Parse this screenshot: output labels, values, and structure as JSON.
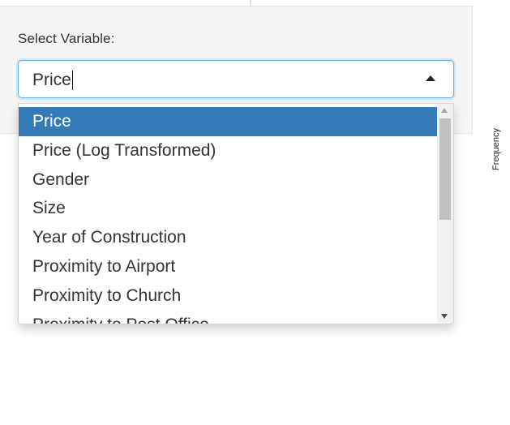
{
  "form": {
    "label": "Select Variable:",
    "selected_value": "Price"
  },
  "dropdown": {
    "options": [
      "Price",
      "Price (Log Transformed)",
      "Gender",
      "Size",
      "Year of Construction",
      "Proximity to Airport",
      "Proximity to Church",
      "Proximity to Post Office"
    ],
    "active_index": 0
  },
  "background": {
    "axis_label": "Frequency"
  },
  "colors": {
    "accent": "#337ab7",
    "focus_border": "#66afe9",
    "well_bg": "#f5f5f5"
  },
  "icons": {
    "select_toggle": "caret-up-icon",
    "scroll_up": "triangle-up-icon",
    "scroll_down": "triangle-down-icon"
  }
}
